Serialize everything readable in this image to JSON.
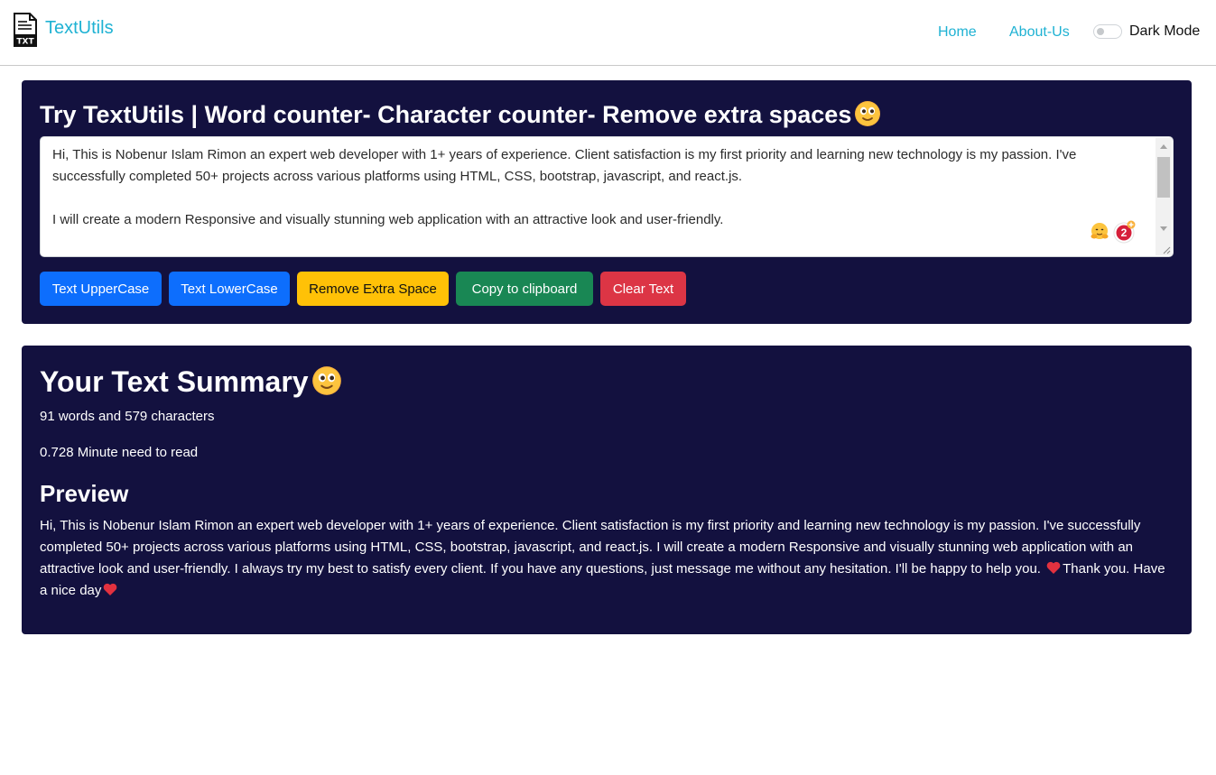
{
  "navbar": {
    "brand_icon": "txt-file-icon",
    "brand_name": "TextUtils",
    "links": [
      "Home",
      "About-Us"
    ],
    "dark_mode_label": "Dark Mode",
    "dark_mode_on": false,
    "accent_color": "#1fb2d3"
  },
  "editor": {
    "heading": "Try TextUtils | Word counter- Character counter- Remove extra spaces",
    "heading_emoji": "smiley-emoji",
    "textarea_value": "Hi, This is Nobenur Islam Rimon an expert web developer with 1+ years of experience. Client satisfaction is my first priority and learning new technology is my passion. I've successfully completed 50+ projects across various platforms using HTML, CSS, bootstrap, javascript, and react.js.\n\nI will create a modern Responsive and visually stunning web application with an attractive look and user-friendly.",
    "extension_badge_count": "2",
    "buttons": {
      "upper": "Text UpperCase",
      "lower": "Text LowerCase",
      "remove_space": "Remove Extra Space",
      "copy": "Copy to clipboard",
      "clear": "Clear Text"
    },
    "card_color": "#13113f"
  },
  "summary": {
    "heading": "Your Text Summary",
    "heading_emoji": "smiley-emoji",
    "counts": "91 words and 579 characters",
    "read_time": "0.728 Minute need to read",
    "preview_heading": "Preview",
    "preview_text": "Hi, This is Nobenur Islam Rimon an expert web developer with 1+ years of experience. Client satisfaction is my first priority and learning new technology is my passion. I've successfully completed 50+ projects across various platforms using HTML, CSS, bootstrap, javascript, and react.js. I will create a modern Responsive and visually stunning web application with an attractive look and user-friendly. I always try my best to satisfy every client. If you have any questions, just message me without any hesitation. I'll be happy to help you.",
    "preview_mid": "Thank you. Have a nice day"
  }
}
